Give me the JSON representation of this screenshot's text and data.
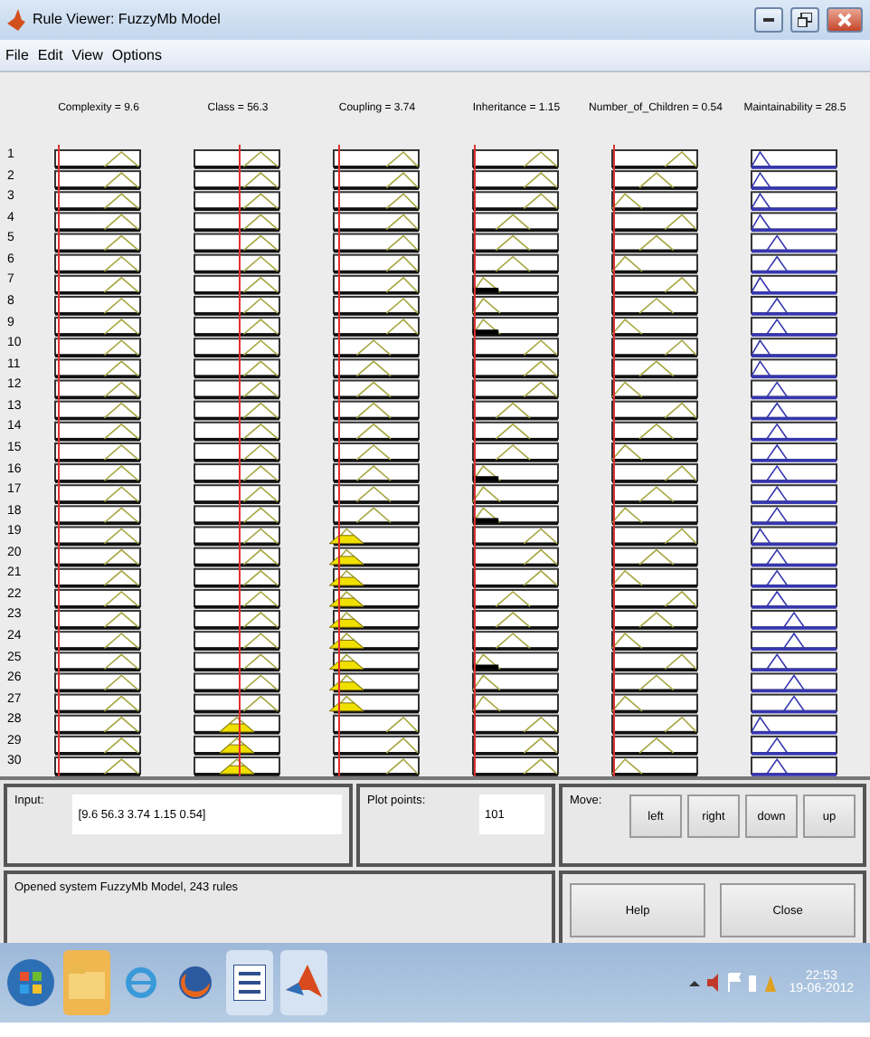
{
  "window": {
    "title": "Rule Viewer: FuzzyMb Model"
  },
  "menu": [
    "File",
    "Edit",
    "View",
    "Options"
  ],
  "columns": [
    {
      "label": "Complexity = 9.6",
      "kind": "input",
      "level": 0.05
    },
    {
      "label": "Class = 56.3",
      "kind": "input",
      "level": 0.55
    },
    {
      "label": "Coupling = 3.74",
      "kind": "input",
      "level": 0.08
    },
    {
      "label": "Inheritance = 1.15",
      "kind": "input",
      "level": 0.02
    },
    {
      "label": "Number_of_Children = 0.54",
      "kind": "input",
      "level": 0.01
    },
    {
      "label": "Maintainability = 28.5",
      "kind": "output"
    }
  ],
  "rules": [
    {
      "number": "1",
      "cells": [
        {
          "kind": "high",
          "fired": false
        },
        {
          "kind": "high",
          "fired": false
        },
        {
          "kind": "high",
          "fired": false
        },
        {
          "kind": "high",
          "fired": false
        },
        {
          "kind": "high",
          "fired": false
        },
        {
          "kind": "low",
          "fired": false
        }
      ]
    },
    {
      "number": "2",
      "cells": [
        {
          "kind": "high",
          "fired": false
        },
        {
          "kind": "high",
          "fired": false
        },
        {
          "kind": "high",
          "fired": false
        },
        {
          "kind": "high",
          "fired": false
        },
        {
          "kind": "mid",
          "fired": false
        },
        {
          "kind": "low",
          "fired": false
        }
      ]
    },
    {
      "number": "3",
      "cells": [
        {
          "kind": "high",
          "fired": false
        },
        {
          "kind": "high",
          "fired": false
        },
        {
          "kind": "high",
          "fired": false
        },
        {
          "kind": "high",
          "fired": false
        },
        {
          "kind": "low",
          "fired": false
        },
        {
          "kind": "low",
          "fired": false
        }
      ]
    },
    {
      "number": "4",
      "cells": [
        {
          "kind": "high",
          "fired": false
        },
        {
          "kind": "high",
          "fired": false
        },
        {
          "kind": "high",
          "fired": false
        },
        {
          "kind": "mid",
          "fired": false
        },
        {
          "kind": "high",
          "fired": false
        },
        {
          "kind": "low",
          "fired": false
        }
      ]
    },
    {
      "number": "5",
      "cells": [
        {
          "kind": "high",
          "fired": false
        },
        {
          "kind": "high",
          "fired": false
        },
        {
          "kind": "high",
          "fired": false
        },
        {
          "kind": "mid",
          "fired": false
        },
        {
          "kind": "mid",
          "fired": false
        },
        {
          "kind": "mid",
          "fired": false
        }
      ]
    },
    {
      "number": "6",
      "cells": [
        {
          "kind": "high",
          "fired": false
        },
        {
          "kind": "high",
          "fired": false
        },
        {
          "kind": "high",
          "fired": false
        },
        {
          "kind": "mid",
          "fired": false
        },
        {
          "kind": "low",
          "fired": false
        },
        {
          "kind": "mid",
          "fired": false
        }
      ]
    },
    {
      "number": "7",
      "cells": [
        {
          "kind": "high",
          "fired": false
        },
        {
          "kind": "high",
          "fired": false
        },
        {
          "kind": "high",
          "fired": false
        },
        {
          "kind": "low",
          "fired": true
        },
        {
          "kind": "high",
          "fired": false
        },
        {
          "kind": "low",
          "fired": false
        }
      ]
    },
    {
      "number": "8",
      "cells": [
        {
          "kind": "high",
          "fired": false
        },
        {
          "kind": "high",
          "fired": false
        },
        {
          "kind": "high",
          "fired": false
        },
        {
          "kind": "low",
          "fired": false
        },
        {
          "kind": "mid",
          "fired": false
        },
        {
          "kind": "mid",
          "fired": false
        }
      ]
    },
    {
      "number": "9",
      "cells": [
        {
          "kind": "high",
          "fired": false
        },
        {
          "kind": "high",
          "fired": false
        },
        {
          "kind": "high",
          "fired": false
        },
        {
          "kind": "low",
          "fired": true
        },
        {
          "kind": "low",
          "fired": false
        },
        {
          "kind": "mid",
          "fired": false
        }
      ]
    },
    {
      "number": "10",
      "cells": [
        {
          "kind": "high",
          "fired": false
        },
        {
          "kind": "high",
          "fired": false
        },
        {
          "kind": "mid",
          "fired": false
        },
        {
          "kind": "high",
          "fired": false
        },
        {
          "kind": "high",
          "fired": false
        },
        {
          "kind": "low",
          "fired": false
        }
      ]
    },
    {
      "number": "11",
      "cells": [
        {
          "kind": "high",
          "fired": false
        },
        {
          "kind": "high",
          "fired": false
        },
        {
          "kind": "mid",
          "fired": false
        },
        {
          "kind": "high",
          "fired": false
        },
        {
          "kind": "mid",
          "fired": false
        },
        {
          "kind": "low",
          "fired": false
        }
      ]
    },
    {
      "number": "12",
      "cells": [
        {
          "kind": "high",
          "fired": false
        },
        {
          "kind": "high",
          "fired": false
        },
        {
          "kind": "mid",
          "fired": false
        },
        {
          "kind": "high",
          "fired": false
        },
        {
          "kind": "low",
          "fired": false
        },
        {
          "kind": "mid",
          "fired": false
        }
      ]
    },
    {
      "number": "13",
      "cells": [
        {
          "kind": "high",
          "fired": false
        },
        {
          "kind": "high",
          "fired": false
        },
        {
          "kind": "mid",
          "fired": false
        },
        {
          "kind": "mid",
          "fired": false
        },
        {
          "kind": "high",
          "fired": false
        },
        {
          "kind": "mid",
          "fired": false
        }
      ]
    },
    {
      "number": "14",
      "cells": [
        {
          "kind": "high",
          "fired": false
        },
        {
          "kind": "high",
          "fired": false
        },
        {
          "kind": "mid",
          "fired": false
        },
        {
          "kind": "mid",
          "fired": false
        },
        {
          "kind": "mid",
          "fired": false
        },
        {
          "kind": "mid",
          "fired": false
        }
      ]
    },
    {
      "number": "15",
      "cells": [
        {
          "kind": "high",
          "fired": false
        },
        {
          "kind": "high",
          "fired": false
        },
        {
          "kind": "mid",
          "fired": false
        },
        {
          "kind": "mid",
          "fired": false
        },
        {
          "kind": "low",
          "fired": false
        },
        {
          "kind": "mid",
          "fired": false
        }
      ]
    },
    {
      "number": "16",
      "cells": [
        {
          "kind": "high",
          "fired": false
        },
        {
          "kind": "high",
          "fired": false
        },
        {
          "kind": "mid",
          "fired": false
        },
        {
          "kind": "low",
          "fired": true
        },
        {
          "kind": "high",
          "fired": false
        },
        {
          "kind": "mid",
          "fired": false
        }
      ]
    },
    {
      "number": "17",
      "cells": [
        {
          "kind": "high",
          "fired": false
        },
        {
          "kind": "high",
          "fired": false
        },
        {
          "kind": "mid",
          "fired": false
        },
        {
          "kind": "low",
          "fired": false
        },
        {
          "kind": "mid",
          "fired": false
        },
        {
          "kind": "mid",
          "fired": false
        }
      ]
    },
    {
      "number": "18",
      "cells": [
        {
          "kind": "high",
          "fired": false
        },
        {
          "kind": "high",
          "fired": false
        },
        {
          "kind": "mid",
          "fired": false
        },
        {
          "kind": "low",
          "fired": true
        },
        {
          "kind": "low",
          "fired": false
        },
        {
          "kind": "mid",
          "fired": false
        }
      ]
    },
    {
      "number": "19",
      "cells": [
        {
          "kind": "high",
          "fired": false
        },
        {
          "kind": "high",
          "fired": false
        },
        {
          "kind": "low",
          "fired": true
        },
        {
          "kind": "high",
          "fired": false
        },
        {
          "kind": "high",
          "fired": false
        },
        {
          "kind": "low",
          "fired": false
        }
      ]
    },
    {
      "number": "20",
      "cells": [
        {
          "kind": "high",
          "fired": false
        },
        {
          "kind": "high",
          "fired": false
        },
        {
          "kind": "low",
          "fired": true
        },
        {
          "kind": "high",
          "fired": false
        },
        {
          "kind": "mid",
          "fired": false
        },
        {
          "kind": "mid",
          "fired": false
        }
      ]
    },
    {
      "number": "21",
      "cells": [
        {
          "kind": "high",
          "fired": false
        },
        {
          "kind": "high",
          "fired": false
        },
        {
          "kind": "low",
          "fired": true
        },
        {
          "kind": "high",
          "fired": false
        },
        {
          "kind": "low",
          "fired": false
        },
        {
          "kind": "mid",
          "fired": false
        }
      ]
    },
    {
      "number": "22",
      "cells": [
        {
          "kind": "high",
          "fired": false
        },
        {
          "kind": "high",
          "fired": false
        },
        {
          "kind": "low",
          "fired": true
        },
        {
          "kind": "mid",
          "fired": false
        },
        {
          "kind": "high",
          "fired": false
        },
        {
          "kind": "mid",
          "fired": false
        }
      ]
    },
    {
      "number": "23",
      "cells": [
        {
          "kind": "high",
          "fired": false
        },
        {
          "kind": "high",
          "fired": false
        },
        {
          "kind": "low",
          "fired": true
        },
        {
          "kind": "mid",
          "fired": false
        },
        {
          "kind": "mid",
          "fired": false
        },
        {
          "kind": "high",
          "fired": false
        }
      ]
    },
    {
      "number": "24",
      "cells": [
        {
          "kind": "high",
          "fired": false
        },
        {
          "kind": "high",
          "fired": false
        },
        {
          "kind": "low",
          "fired": true
        },
        {
          "kind": "mid",
          "fired": false
        },
        {
          "kind": "low",
          "fired": false
        },
        {
          "kind": "high",
          "fired": false
        }
      ]
    },
    {
      "number": "25",
      "cells": [
        {
          "kind": "high",
          "fired": false
        },
        {
          "kind": "high",
          "fired": false
        },
        {
          "kind": "low",
          "fired": true
        },
        {
          "kind": "low",
          "fired": true
        },
        {
          "kind": "high",
          "fired": false
        },
        {
          "kind": "mid",
          "fired": false
        }
      ]
    },
    {
      "number": "26",
      "cells": [
        {
          "kind": "high",
          "fired": false
        },
        {
          "kind": "high",
          "fired": false
        },
        {
          "kind": "low",
          "fired": true
        },
        {
          "kind": "low",
          "fired": false
        },
        {
          "kind": "mid",
          "fired": false
        },
        {
          "kind": "high",
          "fired": false
        }
      ]
    },
    {
      "number": "27",
      "cells": [
        {
          "kind": "high",
          "fired": false
        },
        {
          "kind": "high",
          "fired": false
        },
        {
          "kind": "low",
          "fired": true
        },
        {
          "kind": "low",
          "fired": false
        },
        {
          "kind": "low",
          "fired": false
        },
        {
          "kind": "high",
          "fired": false
        }
      ]
    },
    {
      "number": "28",
      "cells": [
        {
          "kind": "high",
          "fired": false
        },
        {
          "kind": "mid",
          "fired": true
        },
        {
          "kind": "high",
          "fired": false
        },
        {
          "kind": "high",
          "fired": false
        },
        {
          "kind": "high",
          "fired": false
        },
        {
          "kind": "low",
          "fired": false
        }
      ]
    },
    {
      "number": "29",
      "cells": [
        {
          "kind": "high",
          "fired": false
        },
        {
          "kind": "mid",
          "fired": true
        },
        {
          "kind": "high",
          "fired": false
        },
        {
          "kind": "high",
          "fired": false
        },
        {
          "kind": "mid",
          "fired": false
        },
        {
          "kind": "mid",
          "fired": false
        }
      ]
    },
    {
      "number": "30",
      "cells": [
        {
          "kind": "high",
          "fired": false
        },
        {
          "kind": "mid",
          "fired": true
        },
        {
          "kind": "high",
          "fired": false
        },
        {
          "kind": "high",
          "fired": false
        },
        {
          "kind": "low",
          "fired": false
        },
        {
          "kind": "mid",
          "fired": false
        }
      ]
    }
  ],
  "input": {
    "label": "Input:",
    "value": "[9.6 56.3 3.74 1.15 0.54]"
  },
  "plot_points": {
    "label": "Plot points:",
    "value": "101"
  },
  "move": {
    "label": "Move:",
    "buttons": [
      "left",
      "right",
      "down",
      "up"
    ]
  },
  "status": "Opened system FuzzyMb Model, 243 rules",
  "buttons": [
    "Help",
    "Close"
  ],
  "taskbar": {
    "time": "22:53",
    "date": "19-06-2012"
  }
}
